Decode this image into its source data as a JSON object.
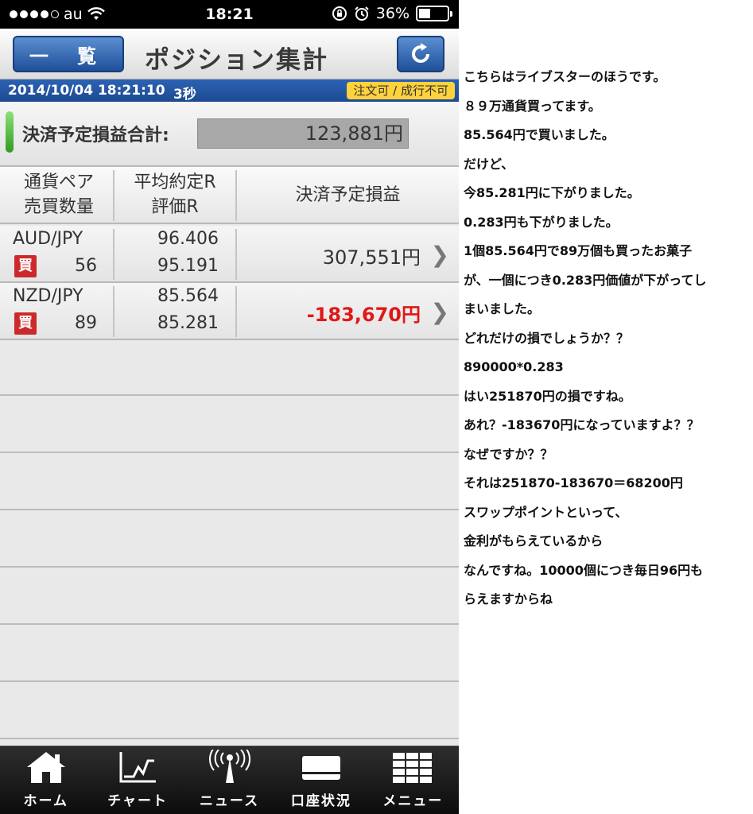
{
  "status": {
    "carrier": "au",
    "time": "18:21",
    "battery": "36%",
    "battery_level": 0.36
  },
  "header": {
    "list_button": "一 覧",
    "title": "ポジション集計"
  },
  "info": {
    "datetime": "2014/10/04 18:21:10",
    "interval": "3秒",
    "order_status": "注文可 / 成行不可"
  },
  "total": {
    "label": "決済予定損益合計:",
    "value": "123,881円"
  },
  "columns": {
    "pair": "通貨ペア",
    "qty": "売買数量",
    "avg_rate": "平均約定R",
    "eval_rate": "評価R",
    "pnl": "決済予定損益"
  },
  "positions": [
    {
      "pair": "AUD/JPY",
      "side": "買",
      "qty": "56",
      "avg_rate": "96.406",
      "eval_rate": "95.191",
      "pnl": "307,551円"
    },
    {
      "pair": "NZD/JPY",
      "side": "買",
      "qty": "89",
      "avg_rate": "85.564",
      "eval_rate": "85.281",
      "pnl": "-183,670円"
    }
  ],
  "tabs": [
    "ホーム",
    "チャート",
    "ニュース",
    "口座状況",
    "メニュー"
  ],
  "colors": {
    "negative": "#e01818",
    "accent": "#1f4f9a",
    "buy_badge": "#cc2a2a",
    "order_badge": "#ffd23c"
  },
  "notes": [
    "こちらはライブスターのほうです。",
    "８９万通貨買ってます。",
    "85.564円で買いました。",
    "だけど、",
    "今85.281円に下がりました。",
    "0.283円も下がりました。",
    "1個85.564円で89万個も買ったお菓子",
    "が、一個につき0.283円価値が下がってし",
    "まいました。",
    "どれだけの損でしょうか？？",
    "890000*0.283",
    "はい251870円の損ですね。",
    "あれ？-183670円になっていますよ？？",
    "なぜですか？？",
    "それは251870-183670＝68200円",
    "スワップポイントといって、",
    "金利がもらえているから",
    "なんですね。10000個につき毎日96円も",
    "らえますからね"
  ]
}
